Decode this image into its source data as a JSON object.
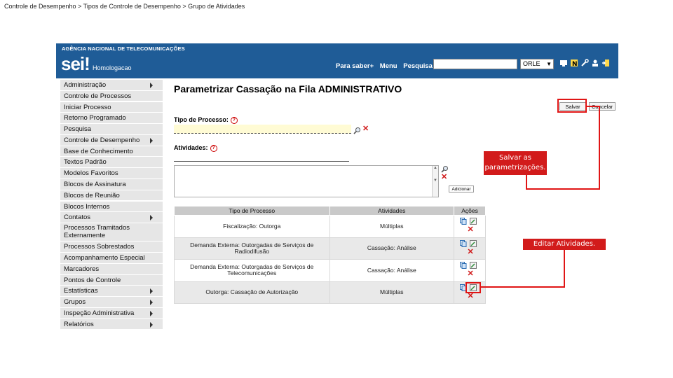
{
  "breadcrumb": "Controle de Desempenho > Tipos de Controle de Desempenho > Grupo de Atividades",
  "header": {
    "agency": "AGÊNCIA NACIONAL DE TELECOMUNICAÇÕES",
    "logo": "sei!",
    "environment": "Homologacao",
    "links": [
      "Para saber+",
      "Menu",
      "Pesquisa"
    ],
    "unit": "ORLE",
    "brand_color": "#1f5c97"
  },
  "sidebar": {
    "items": [
      {
        "label": "Administração",
        "submenu": true
      },
      {
        "label": "Controle de Processos",
        "submenu": false
      },
      {
        "label": "Iniciar Processo",
        "submenu": false
      },
      {
        "label": "Retorno Programado",
        "submenu": false
      },
      {
        "label": "Pesquisa",
        "submenu": false
      },
      {
        "label": "Controle de Desempenho",
        "submenu": true
      },
      {
        "label": "Base de Conhecimento",
        "submenu": false
      },
      {
        "label": "Textos Padrão",
        "submenu": false
      },
      {
        "label": "Modelos Favoritos",
        "submenu": false
      },
      {
        "label": "Blocos de Assinatura",
        "submenu": false
      },
      {
        "label": "Blocos de Reunião",
        "submenu": false
      },
      {
        "label": "Blocos Internos",
        "submenu": false
      },
      {
        "label": "Contatos",
        "submenu": true
      },
      {
        "label": "Processos Tramitados Externamente",
        "submenu": false
      },
      {
        "label": "Processos Sobrestados",
        "submenu": false
      },
      {
        "label": "Acompanhamento Especial",
        "submenu": false
      },
      {
        "label": "Marcadores",
        "submenu": false
      },
      {
        "label": "Pontos de Controle",
        "submenu": false
      },
      {
        "label": "Estatísticas",
        "submenu": true
      },
      {
        "label": "Grupos",
        "submenu": true
      },
      {
        "label": "Inspeção Administrativa",
        "submenu": true
      },
      {
        "label": "Relatórios",
        "submenu": true
      }
    ]
  },
  "main": {
    "title": "Parametrizar Cassação na Fila ADMINISTRATIVO",
    "save_label": "Salvar",
    "cancel_label": "Cancelar",
    "tipo_label": "Tipo de Processo:",
    "atividades_label": "Atividades:",
    "help_symbol": "?",
    "add_label": "Adicionar",
    "table": {
      "headers": [
        "Tipo de Processo",
        "Atividades",
        "Ações"
      ],
      "rows": [
        {
          "tipo": "Fiscalização: Outorga",
          "atividades": "Múltiplas"
        },
        {
          "tipo": "Demanda Externa: Outorgadas de Serviços de Radiodifusão",
          "atividades": "Cassação: Análise"
        },
        {
          "tipo": "Demanda Externa: Outorgadas de Serviços de Telecomunicações",
          "atividades": "Cassação: Análise"
        },
        {
          "tipo": "Outorga: Cassação de Autorização",
          "atividades": "Múltiplas"
        }
      ]
    }
  },
  "annotations": {
    "save_callout": "Salvar as parametrizações.",
    "edit_callout": "Editar Atividades.",
    "color": "#d21b1b"
  }
}
